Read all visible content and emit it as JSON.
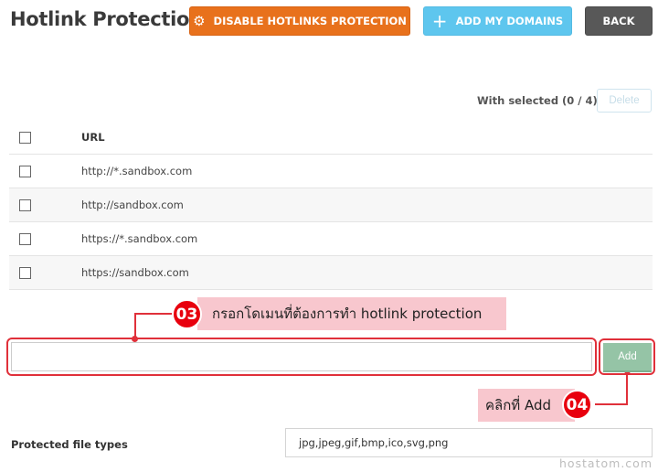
{
  "header": {
    "title": "Hotlink Protection",
    "disable_button": {
      "label": "DISABLE HOTLINKS PROTECTION",
      "icon": "gear-icon"
    },
    "add_domains_button": {
      "label": "ADD MY DOMAINS",
      "icon": "plus-icon"
    },
    "back_button": {
      "label": "BACK"
    }
  },
  "toolbar": {
    "with_selected": "With selected (0 / 4):",
    "delete_label": "Delete"
  },
  "table": {
    "column_header": "URL",
    "rows": [
      {
        "url": "http://*.sandbox.com",
        "checked": false
      },
      {
        "url": "http://sandbox.com",
        "checked": false
      },
      {
        "url": "https://*.sandbox.com",
        "checked": false
      },
      {
        "url": "https://sandbox.com",
        "checked": false
      }
    ]
  },
  "annotations": {
    "step3": {
      "number": "03",
      "text": "กรอกโดเมนที่ต้องการทำ hotlink protection"
    },
    "step4": {
      "number": "04",
      "text": "คลิกที่ Add"
    },
    "highlight_color": "#e0303a",
    "callout_color": "#f8c7ce"
  },
  "add_form": {
    "domain_value": "",
    "add_label": "Add"
  },
  "file_types": {
    "label": "Protected file types",
    "value": "jpg,jpeg,gif,bmp,ico,svg,png"
  },
  "watermark": "hostatom.com",
  "colors": {
    "orange": "#e8711c",
    "cyan": "#5ec6ee",
    "gray": "#585858",
    "add_green": "#95c4a6"
  }
}
